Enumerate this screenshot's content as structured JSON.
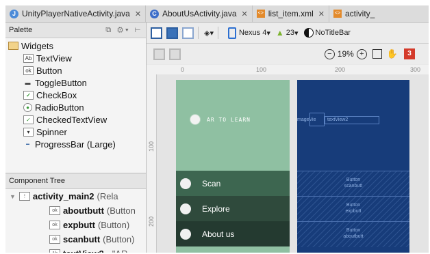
{
  "tabs": [
    {
      "label": "UnityPlayerNativeActivity.java",
      "kind": "java"
    },
    {
      "label": "AboutUsActivity.java",
      "kind": "class"
    },
    {
      "label": "list_item.xml",
      "kind": "xml"
    },
    {
      "label": "activity_",
      "kind": "xml"
    }
  ],
  "palette": {
    "title": "Palette",
    "group": "Widgets",
    "items": [
      "TextView",
      "Button",
      "ToggleButton",
      "CheckBox",
      "RadioButton",
      "CheckedTextView",
      "Spinner",
      "ProgressBar (Large)"
    ]
  },
  "component_tree": {
    "title": "Component Tree",
    "root": {
      "name": "activity_main2",
      "type": "(Rela"
    },
    "children": [
      {
        "name": "aboutbutt",
        "type": "(Button"
      },
      {
        "name": "expbutt",
        "type": "(Button)"
      },
      {
        "name": "scanbutt",
        "type": "(Button)"
      },
      {
        "name": "textView2",
        "type": "- \"AR"
      }
    ]
  },
  "toolbar": {
    "device": "Nexus 4",
    "api": "23",
    "theme": "NoTitleBar",
    "zoom": "19%"
  },
  "ruler": {
    "h_marks": [
      "0",
      "100",
      "200",
      "300"
    ],
    "v_marks": [
      "100",
      "200"
    ]
  },
  "design": {
    "title": "AR TO LEARN",
    "buttons": [
      "Scan",
      "Explore",
      "About us"
    ],
    "bg_color": "#8fc0a2",
    "button_colors": [
      "#3d6650",
      "#2f4a3c",
      "#243a30"
    ]
  },
  "blueprint": {
    "image_label": "mageVie",
    "text_label": "textView2",
    "buttons": [
      {
        "type": "Button",
        "id": "scanbutt"
      },
      {
        "type": "Button",
        "id": "expbutt"
      },
      {
        "type": "Button",
        "id": "aboutbutt"
      }
    ],
    "bg_color": "#173c7a"
  },
  "error_count": "3"
}
